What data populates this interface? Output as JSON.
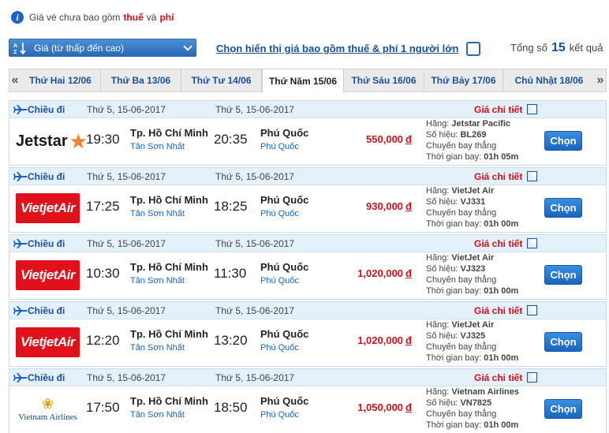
{
  "notice": {
    "prefix": "Giá vé chưa bao gồm",
    "tax": "thuế",
    "and": "và",
    "fee": "phí"
  },
  "sort": {
    "selected": "Giá (từ thấp đến cao)"
  },
  "toggle_label": "Chọn hiển thị giá bao gồm thuế & phí 1 người lớn",
  "total": {
    "prefix": "Tổng số",
    "count": "15",
    "suffix": "kết quả"
  },
  "date_tabs": [
    {
      "label": "Thứ Hai 12/06",
      "active": false
    },
    {
      "label": "Thứ Ba 13/06",
      "active": false
    },
    {
      "label": "Thứ Tư 14/06",
      "active": false
    },
    {
      "label": "Thứ Năm 15/06",
      "active": true
    },
    {
      "label": "Thứ Sáu 16/06",
      "active": false
    },
    {
      "label": "Thứ Bảy 17/06",
      "active": false
    },
    {
      "label": "Chủ Nhật 18/06",
      "active": false
    }
  ],
  "labels": {
    "direction": "Chiều đi",
    "detail": "Giá chi tiết",
    "airline": "Hãng:",
    "flight_no": "Số hiệu:",
    "direct": "Chuyến bay thẳng",
    "duration": "Thời gian bay:",
    "choose": "Chọn",
    "currency": "đ"
  },
  "flights": [
    {
      "dep_date": "Thứ 5, 15-06-2017",
      "arr_date": "Thứ 5, 15-06-2017",
      "logo": "jetstar",
      "logo_text": "Jetstar",
      "dep_time": "19:30",
      "dep_city": "Tp. Hồ Chí Minh",
      "dep_airport": "Tân Sơn Nhất",
      "arr_time": "20:35",
      "arr_city": "Phú Quốc",
      "arr_airport": "Phú Quốc",
      "price": "550,000",
      "airline": "Jetstar Pacific",
      "flight_no": "BL269",
      "duration": "01h 05m"
    },
    {
      "dep_date": "Thứ 5, 15-06-2017",
      "arr_date": "Thứ 5, 15-06-2017",
      "logo": "vietjet",
      "logo_text": "VietjetAir",
      "dep_time": "17:25",
      "dep_city": "Tp. Hồ Chí Minh",
      "dep_airport": "Tân Sơn Nhất",
      "arr_time": "18:25",
      "arr_city": "Phú Quốc",
      "arr_airport": "Phú Quốc",
      "price": "930,000",
      "airline": "VietJet Air",
      "flight_no": "VJ331",
      "duration": "01h 00m"
    },
    {
      "dep_date": "Thứ 5, 15-06-2017",
      "arr_date": "Thứ 5, 15-06-2017",
      "logo": "vietjet",
      "logo_text": "VietjetAir",
      "dep_time": "10:30",
      "dep_city": "Tp. Hồ Chí Minh",
      "dep_airport": "Tân Sơn Nhất",
      "arr_time": "11:30",
      "arr_city": "Phú Quốc",
      "arr_airport": "Phú Quốc",
      "price": "1,020,000",
      "airline": "VietJet Air",
      "flight_no": "VJ323",
      "duration": "01h 00m"
    },
    {
      "dep_date": "Thứ 5, 15-06-2017",
      "arr_date": "Thứ 5, 15-06-2017",
      "logo": "vietjet",
      "logo_text": "VietjetAir",
      "dep_time": "12:20",
      "dep_city": "Tp. Hồ Chí Minh",
      "dep_airport": "Tân Sơn Nhất",
      "arr_time": "13:20",
      "arr_city": "Phú Quốc",
      "arr_airport": "Phú Quốc",
      "price": "1,020,000",
      "airline": "VietJet Air",
      "flight_no": "VJ325",
      "duration": "01h 00m"
    },
    {
      "dep_date": "Thứ 5, 15-06-2017",
      "arr_date": "Thứ 5, 15-06-2017",
      "logo": "vna",
      "logo_text": "Vietnam Airlines",
      "dep_time": "17:50",
      "dep_city": "Tp. Hồ Chí Minh",
      "dep_airport": "Tân Sơn Nhất",
      "arr_time": "18:50",
      "arr_city": "Phú Quốc",
      "arr_airport": "Phú Quốc",
      "price": "1,050,000",
      "airline": "Vietnam Airlines",
      "flight_no": "VN7825",
      "duration": "01h 00m"
    }
  ],
  "icons": {
    "info": "info-icon",
    "sort": "sort-ascending-icon",
    "plane": "plane-icon",
    "external": "external-link-icon"
  },
  "colors": {
    "accent": "#1a4f9a",
    "price": "#d0121b",
    "button": "#1865c0"
  }
}
